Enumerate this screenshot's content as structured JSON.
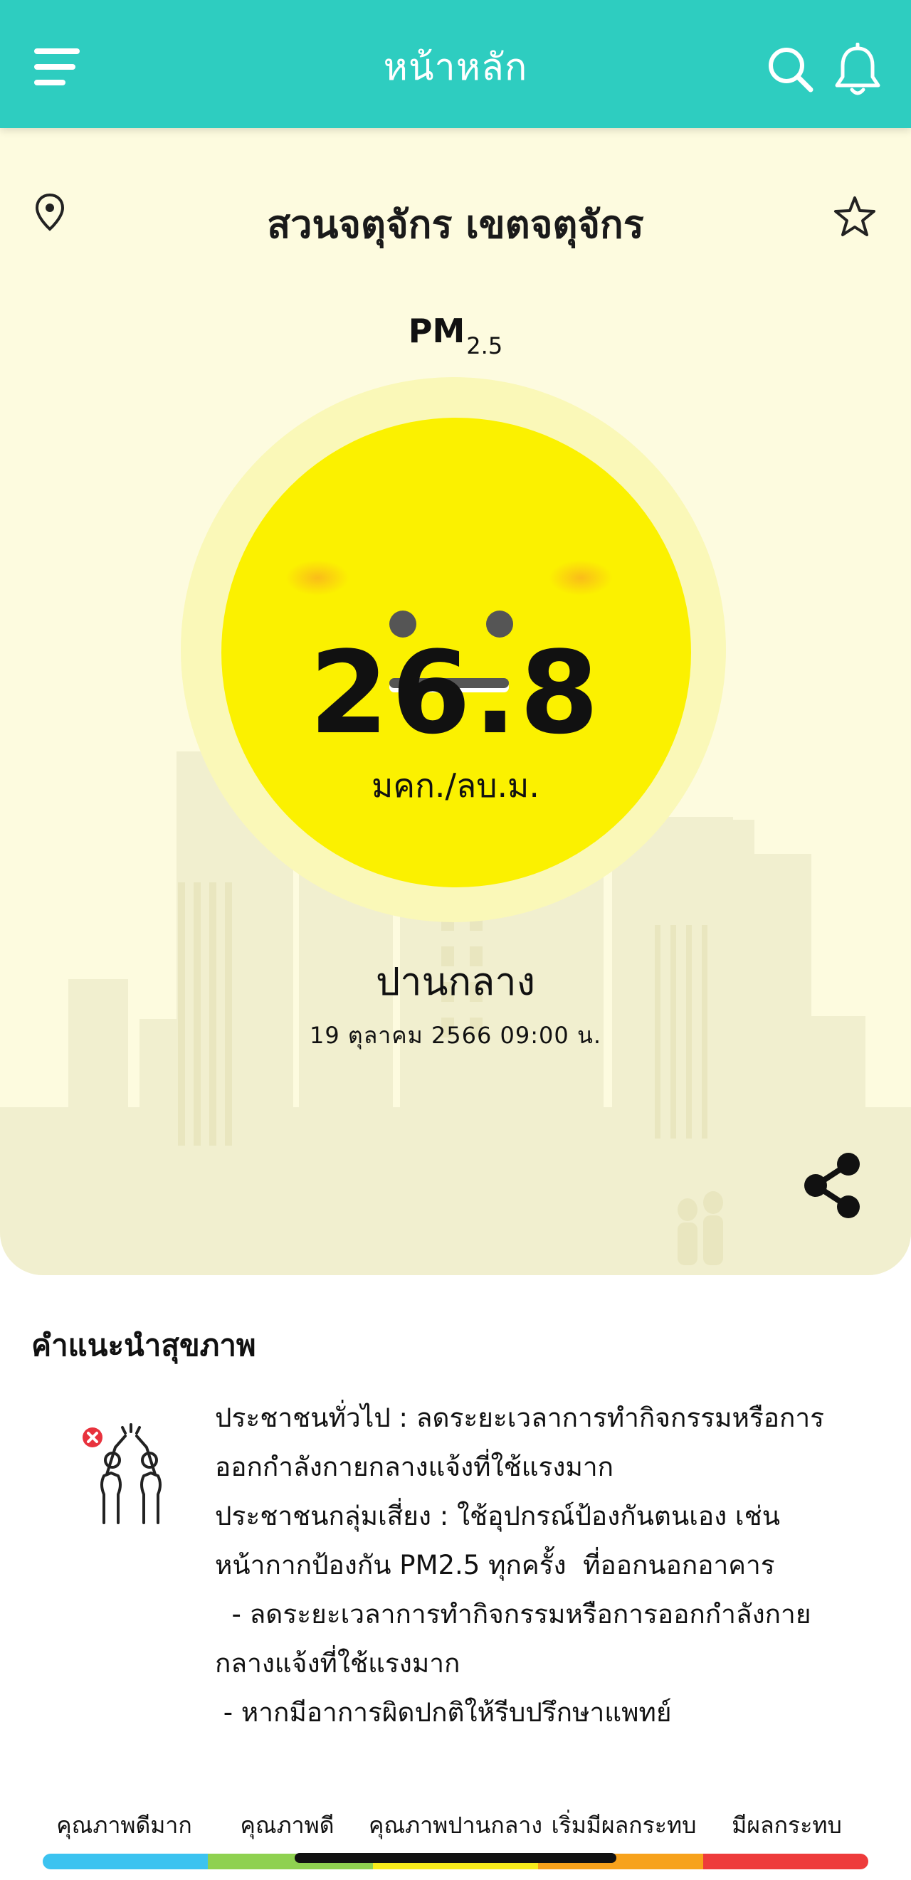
{
  "header": {
    "title": "หน้าหลัก",
    "icons": [
      "menu-icon",
      "search-icon",
      "bell-icon"
    ]
  },
  "location": {
    "name": "สวนจตุจักร เขตจตุจักร",
    "icons": [
      "map-pin-icon",
      "star-icon"
    ]
  },
  "pm": {
    "label": "PM",
    "subscript": "2.5",
    "value": "26.8",
    "unit": "มคก./ลบ.ม.",
    "status": "ปานกลาง",
    "timestamp": "19 ตุลาคม 2566  09:00 น.",
    "color": "#fbf100",
    "face": "neutral-face-icon"
  },
  "share": {
    "icon": "share-icon"
  },
  "health": {
    "title": "คำแนะนำสุขภาพ",
    "icon": "no-exercise-icon",
    "lines": [
      "ประชาชนทั่วไป : ลดระยะเวลาการทำกิจกรรมหรือการ",
      "ออกกำลังกายกลางแจ้งที่ใช้แรงมาก",
      "ประชาชนกลุ่มเสี่ยง : ใช้อุปกรณ์ป้องกันตนเอง เช่น",
      "หน้ากากป้องกัน PM2.5 ทุกครั้ง  ที่ออกนอกอาคาร",
      "  - ลดระยะเวลาการทำกิจกรรมหรือการออกกำลังกาย",
      "กลางแจ้งที่ใช้แรงมาก",
      " - หากมีอาการผิดปกติให้รีบปรึกษาแพทย์"
    ]
  },
  "legend": {
    "labels": [
      "คุณภาพดีมาก",
      "คุณภาพดี",
      "คุณภาพปานกลาง",
      "เริ่มมีผลกระทบ",
      "มีผลกระทบ"
    ],
    "colors": [
      "#3cc3f0",
      "#8fd150",
      "#f7ec1c",
      "#f7a21b",
      "#ee3b3b"
    ]
  }
}
